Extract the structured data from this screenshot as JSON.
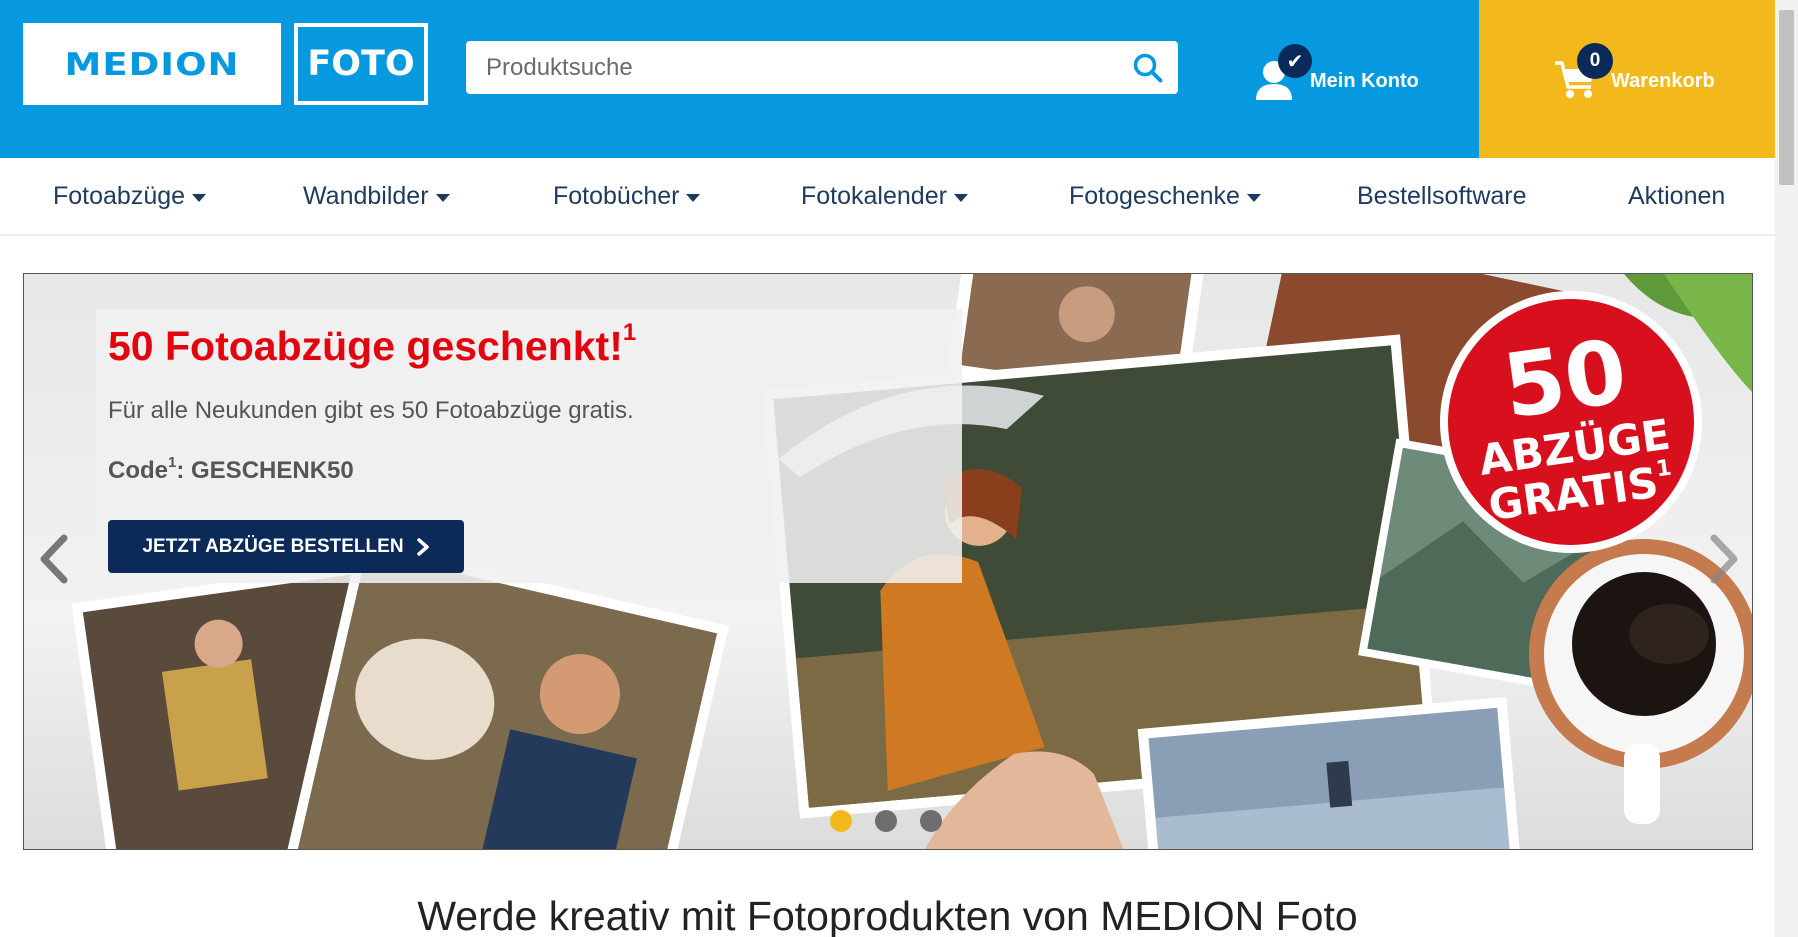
{
  "header": {
    "logo": {
      "brand": "MEDION",
      "sub": "FOTO"
    },
    "search": {
      "placeholder": "Produktsuche"
    },
    "account": {
      "label": "Mein Konto"
    },
    "cart": {
      "label": "Warenkorb",
      "count": "0"
    },
    "colors": {
      "header_bg": "#0799e0",
      "cart_bg": "#f3b91c",
      "badge_bg": "#0a2b5a"
    }
  },
  "nav": {
    "items": [
      {
        "label": "Fotoabzüge",
        "dropdown": true
      },
      {
        "label": "Wandbilder",
        "dropdown": true
      },
      {
        "label": "Fotobücher",
        "dropdown": true
      },
      {
        "label": "Fotokalender",
        "dropdown": true
      },
      {
        "label": "Fotogeschenke",
        "dropdown": true
      },
      {
        "label": "Bestellsoftware",
        "dropdown": false
      },
      {
        "label": "Aktionen",
        "dropdown": false
      }
    ]
  },
  "hero": {
    "title": "50 Fotoabzüge geschenkt!",
    "title_sup": "1",
    "subtitle": "Für alle Neukunden gibt es 50 Fotoabzüge gratis.",
    "code_label": "Code",
    "code_sup": "1",
    "code_value": ": GESCHENK50",
    "cta": "JETZT ABZÜGE BESTELLEN",
    "badge": {
      "number": "50",
      "line1": "ABZÜGE",
      "line2": "GRATIS",
      "sup": "1"
    },
    "slides": {
      "count": 3,
      "active": 1
    },
    "colors": {
      "title": "#e2050f",
      "cta_bg": "#0c2a58",
      "badge": "#d8101d",
      "dot_active": "#f3b91c"
    }
  },
  "section": {
    "title": "Werde kreativ mit Fotoprodukten von MEDION Foto"
  }
}
